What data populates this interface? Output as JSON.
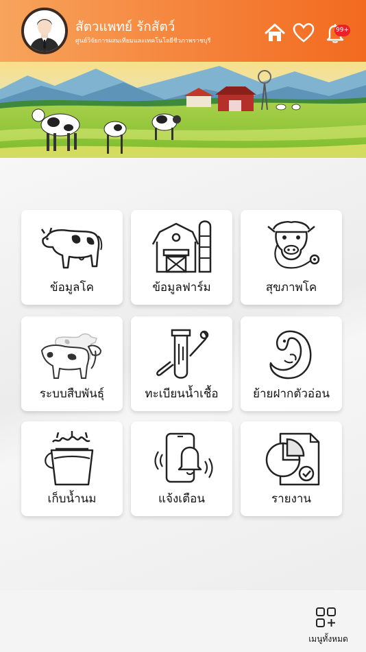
{
  "header": {
    "user_name": "สัตวแพทย์ รักสัตว์",
    "organization": "ศูนย์วิจัยการผสมเทียมและเทคโนโลยีชีวภาพราชบุรี",
    "notification_badge": "99+"
  },
  "menu": {
    "cow_info": "ข้อมูลโค",
    "farm_info": "ข้อมูลฟาร์ม",
    "cow_health": "สุขภาพโค",
    "breeding": "ระบบสืบพันธุ์",
    "semen_registry": "ทะเบียนน้ำเชื้อ",
    "embryo_transfer": "ย้ายฝากตัวอ่อน",
    "milk_collection": "เก็บน้ำนม",
    "notifications": "แจ้งเตือน",
    "reports": "รายงาน"
  },
  "bottom": {
    "all_menu_label": "เมนูทั้งหมด"
  },
  "colors": {
    "header_start": "#f7a45c",
    "header_end": "#f26a1f",
    "badge": "#e8212b"
  }
}
